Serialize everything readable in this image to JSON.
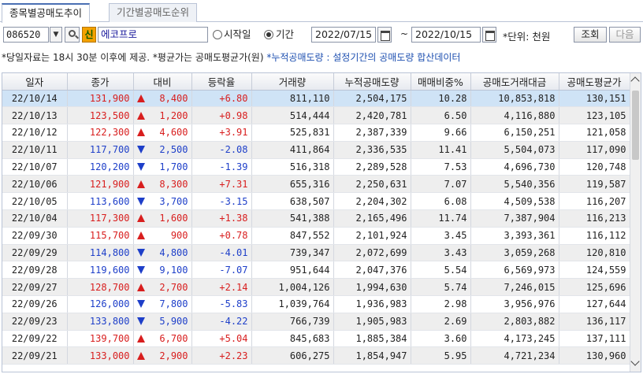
{
  "tabs": [
    "종목별공매도추이",
    "기간별공매도순위"
  ],
  "toolbar": {
    "code": "086520",
    "new_badge": "신",
    "stock_name": "에코프로",
    "radio_start": "시작일",
    "radio_period": "기간",
    "date_from": "2022/07/15",
    "date_to": "2022/10/15",
    "tilde": "~",
    "unit": "*단위: 천원",
    "search_label": "조회",
    "next_label": "다음"
  },
  "notice": {
    "part1": "*당일자료는 18시 30분 이후에 제공. *평균가는 공매도평균가(원) ",
    "part2": "*누적공매도량 : 설정기간의 공매도량 합산데이터"
  },
  "table": {
    "headers": [
      "일자",
      "종가",
      "대비",
      "등락율",
      "거래량",
      "누적공매도량",
      "매매비중%",
      "공매도거래대금",
      "공매도평균가"
    ],
    "rows": [
      {
        "date": "22/10/14",
        "close": "131,900",
        "dir": "up",
        "diff": "8,400",
        "rate": "+6.80",
        "volume": "811,110",
        "cum_short": "2,504,175",
        "share": "10.28",
        "amount": "10,853,818",
        "avg": "130,151"
      },
      {
        "date": "22/10/13",
        "close": "123,500",
        "dir": "up",
        "diff": "1,200",
        "rate": "+0.98",
        "volume": "514,444",
        "cum_short": "2,420,781",
        "share": "6.50",
        "amount": "4,116,880",
        "avg": "123,105"
      },
      {
        "date": "22/10/12",
        "close": "122,300",
        "dir": "up",
        "diff": "4,600",
        "rate": "+3.91",
        "volume": "525,831",
        "cum_short": "2,387,339",
        "share": "9.66",
        "amount": "6,150,251",
        "avg": "121,058"
      },
      {
        "date": "22/10/11",
        "close": "117,700",
        "dir": "down",
        "diff": "2,500",
        "rate": "-2.08",
        "volume": "411,864",
        "cum_short": "2,336,535",
        "share": "11.41",
        "amount": "5,504,073",
        "avg": "117,090"
      },
      {
        "date": "22/10/07",
        "close": "120,200",
        "dir": "down",
        "diff": "1,700",
        "rate": "-1.39",
        "volume": "516,318",
        "cum_short": "2,289,528",
        "share": "7.53",
        "amount": "4,696,730",
        "avg": "120,748"
      },
      {
        "date": "22/10/06",
        "close": "121,900",
        "dir": "up",
        "diff": "8,300",
        "rate": "+7.31",
        "volume": "655,316",
        "cum_short": "2,250,631",
        "share": "7.07",
        "amount": "5,540,356",
        "avg": "119,587"
      },
      {
        "date": "22/10/05",
        "close": "113,600",
        "dir": "down",
        "diff": "3,700",
        "rate": "-3.15",
        "volume": "638,507",
        "cum_short": "2,204,302",
        "share": "6.08",
        "amount": "4,509,538",
        "avg": "116,207"
      },
      {
        "date": "22/10/04",
        "close": "117,300",
        "dir": "up",
        "diff": "1,600",
        "rate": "+1.38",
        "volume": "541,388",
        "cum_short": "2,165,496",
        "share": "11.74",
        "amount": "7,387,904",
        "avg": "116,213"
      },
      {
        "date": "22/09/30",
        "close": "115,700",
        "dir": "up",
        "diff": "900",
        "rate": "+0.78",
        "volume": "847,552",
        "cum_short": "2,101,924",
        "share": "3.45",
        "amount": "3,393,361",
        "avg": "116,112"
      },
      {
        "date": "22/09/29",
        "close": "114,800",
        "dir": "down",
        "diff": "4,800",
        "rate": "-4.01",
        "volume": "739,347",
        "cum_short": "2,072,699",
        "share": "3.43",
        "amount": "3,059,268",
        "avg": "120,810"
      },
      {
        "date": "22/09/28",
        "close": "119,600",
        "dir": "down",
        "diff": "9,100",
        "rate": "-7.07",
        "volume": "951,644",
        "cum_short": "2,047,376",
        "share": "5.54",
        "amount": "6,569,973",
        "avg": "124,559"
      },
      {
        "date": "22/09/27",
        "close": "128,700",
        "dir": "up",
        "diff": "2,700",
        "rate": "+2.14",
        "volume": "1,004,126",
        "cum_short": "1,994,630",
        "share": "5.74",
        "amount": "7,246,015",
        "avg": "125,696"
      },
      {
        "date": "22/09/26",
        "close": "126,000",
        "dir": "down",
        "diff": "7,800",
        "rate": "-5.83",
        "volume": "1,039,764",
        "cum_short": "1,936,983",
        "share": "2.98",
        "amount": "3,956,976",
        "avg": "127,644"
      },
      {
        "date": "22/09/23",
        "close": "133,800",
        "dir": "down",
        "diff": "5,900",
        "rate": "-4.22",
        "volume": "766,739",
        "cum_short": "1,905,983",
        "share": "2.69",
        "amount": "2,803,882",
        "avg": "136,117"
      },
      {
        "date": "22/09/22",
        "close": "139,700",
        "dir": "up",
        "diff": "6,700",
        "rate": "+5.04",
        "volume": "845,683",
        "cum_short": "1,885,384",
        "share": "3.60",
        "amount": "4,173,245",
        "avg": "137,111"
      },
      {
        "date": "22/09/21",
        "close": "133,000",
        "dir": "up",
        "diff": "2,900",
        "rate": "+2.23",
        "volume": "606,275",
        "cum_short": "1,854,947",
        "share": "5.95",
        "amount": "4,721,234",
        "avg": "130,960"
      }
    ]
  },
  "colors": {
    "up": "#d81e1e",
    "down": "#1e3fc9",
    "selected_row": "#cfe3f6",
    "alt_row": "#eeeeee"
  }
}
